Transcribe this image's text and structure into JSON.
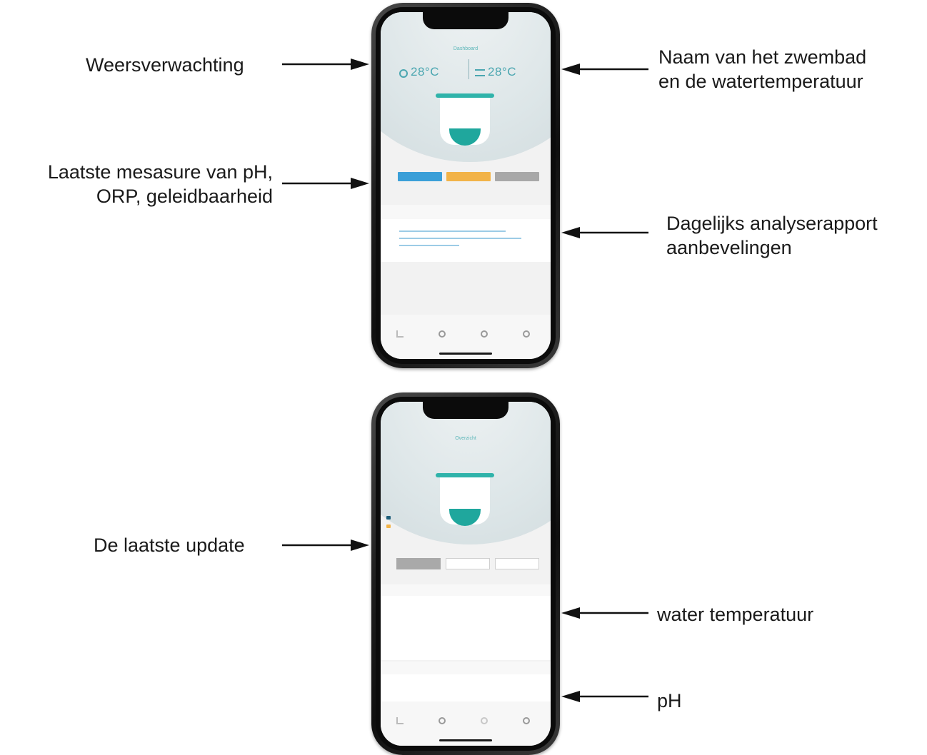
{
  "annotations": {
    "weather": "Weersverwachting",
    "pool_name": "Naam van het zwembad\nen de watertemperatuur",
    "last_measure": "Laatste mesasure van pH,\nORP, geleidbaarheid",
    "daily_report": "Dagelijks analyserapport\naanbevelingen",
    "last_update": "De laatste update",
    "water_temp": "water temperatuur",
    "ph": "pH"
  },
  "phone1": {
    "title": "Dashboard",
    "air_temp": "28°C",
    "water_temp": "28°C",
    "pill_colors": [
      "#3b9fd8",
      "#f2b348",
      "#a8a8a8"
    ]
  },
  "phone2": {
    "title": "Overzicht"
  },
  "colors": {
    "teal": "#1fa79d",
    "accent_blue": "#3b9fd8",
    "accent_orange": "#f2b348"
  }
}
